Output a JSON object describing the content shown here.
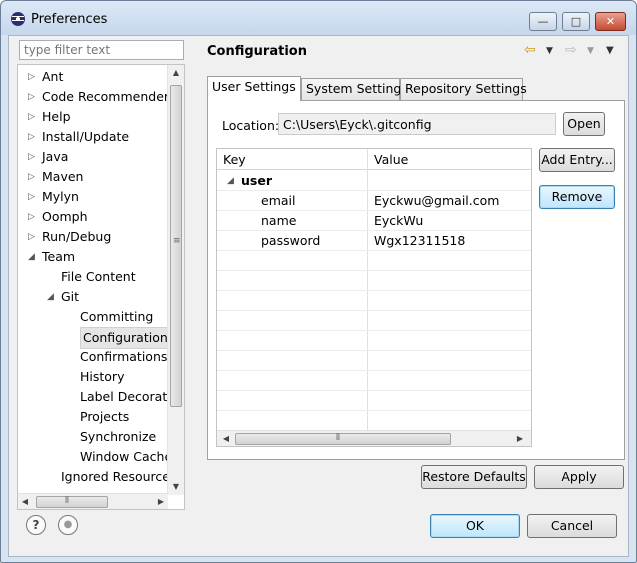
{
  "window": {
    "title": "Preferences",
    "minimize_glyph": "—",
    "maximize_glyph": "□",
    "close_glyph": "✕"
  },
  "filter": {
    "placeholder": "type filter text"
  },
  "tree": {
    "items": [
      {
        "label": "Ant",
        "twisty": "▷",
        "level": 0
      },
      {
        "label": "Code Recommenders",
        "twisty": "▷",
        "level": 0
      },
      {
        "label": "Help",
        "twisty": "▷",
        "level": 0
      },
      {
        "label": "Install/Update",
        "twisty": "▷",
        "level": 0
      },
      {
        "label": "Java",
        "twisty": "▷",
        "level": 0
      },
      {
        "label": "Maven",
        "twisty": "▷",
        "level": 0
      },
      {
        "label": "Mylyn",
        "twisty": "▷",
        "level": 0
      },
      {
        "label": "Oomph",
        "twisty": "▷",
        "level": 0
      },
      {
        "label": "Run/Debug",
        "twisty": "▷",
        "level": 0
      },
      {
        "label": "Team",
        "twisty": "◢",
        "level": 0
      },
      {
        "label": "File Content",
        "twisty": "",
        "level": 1
      },
      {
        "label": "Git",
        "twisty": "◢",
        "level": 1
      },
      {
        "label": "Committing",
        "twisty": "",
        "level": 2
      },
      {
        "label": "Configuration",
        "twisty": "",
        "level": 2
      },
      {
        "label": "Confirmations a",
        "twisty": "",
        "level": 2
      },
      {
        "label": "History",
        "twisty": "",
        "level": 2
      },
      {
        "label": "Label Decoratio",
        "twisty": "",
        "level": 2
      },
      {
        "label": "Projects",
        "twisty": "",
        "level": 2
      },
      {
        "label": "Synchronize",
        "twisty": "",
        "level": 2
      },
      {
        "label": "Window Cache",
        "twisty": "",
        "level": 2
      },
      {
        "label": "Ignored Resource",
        "twisty": "",
        "level": 1
      }
    ],
    "selected_index": 13
  },
  "page": {
    "title": "Configuration",
    "tabs": [
      {
        "label": "User Settings"
      },
      {
        "label": "System Settings"
      },
      {
        "label": "Repository Settings"
      }
    ],
    "location_label": "Location:",
    "location_value": "C:\\Users\\Eyck\\.gitconfig",
    "open_label": "Open",
    "add_entry_label": "Add Entry...",
    "remove_label": "Remove",
    "columns": {
      "key": "Key",
      "value": "Value"
    },
    "section": "user",
    "entries": [
      {
        "key": "email",
        "value": "Eyckwu@gmail.com"
      },
      {
        "key": "name",
        "value": "EyckWu"
      },
      {
        "key": "password",
        "value": "Wgx12311518"
      }
    ]
  },
  "buttons": {
    "restore_defaults": "Restore Defaults",
    "apply": "Apply",
    "ok": "OK",
    "cancel": "Cancel"
  },
  "icons": {
    "help": "?",
    "import_export": "●"
  }
}
